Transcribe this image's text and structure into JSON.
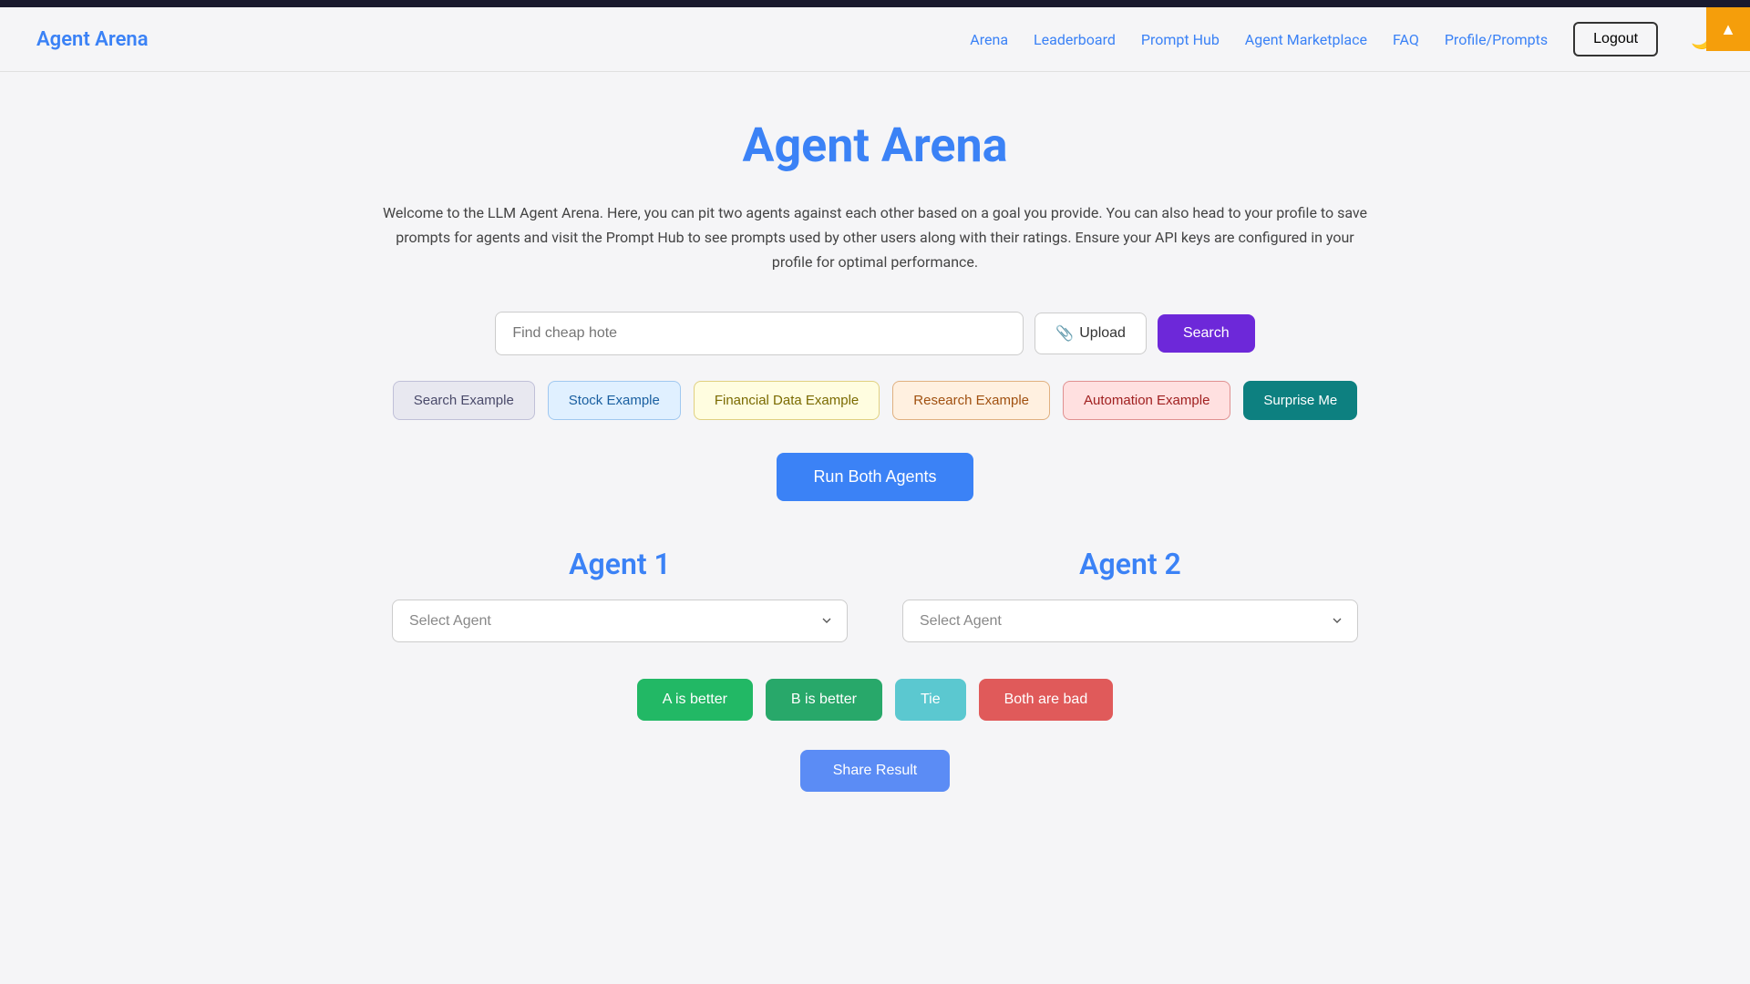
{
  "topBar": {},
  "header": {
    "logo": "Agent Arena",
    "nav": {
      "arena": "Arena",
      "leaderboard": "Leaderboard",
      "promptHub": "Prompt Hub",
      "agentMarketplace": "Agent Marketplace",
      "faq": "FAQ",
      "profilePrompts": "Profile/Prompts",
      "logout": "Logout"
    },
    "darkModeIcon": "🌙",
    "cornerBadge": "▲"
  },
  "main": {
    "title": "Agent Arena",
    "description": "Welcome to the LLM Agent Arena. Here, you can pit two agents against each other based on a goal you provide. You can also head to your profile to save prompts for agents and visit the Prompt Hub to see prompts used by other users along with their ratings. Ensure your API keys are configured in your profile for optimal performance.",
    "search": {
      "placeholder": "Find cheap hote",
      "uploadLabel": "Upload",
      "searchLabel": "Search"
    },
    "examples": {
      "searchExample": "Search Example",
      "stockExample": "Stock Example",
      "financialDataExample": "Financial Data Example",
      "researchExample": "Research Example",
      "automationExample": "Automation Example",
      "surpriseMe": "Surprise Me"
    },
    "runBothAgents": "Run Both Agents",
    "agent1": {
      "title": "Agent 1",
      "selectPlaceholder": "Select Agent"
    },
    "agent2": {
      "title": "Agent 2",
      "selectPlaceholder": "Select Agent"
    },
    "voting": {
      "aIsBetter": "A is better",
      "bIsBetter": "B is better",
      "tie": "Tie",
      "bothAreBad": "Both are bad"
    },
    "shareResult": "Share Result"
  }
}
